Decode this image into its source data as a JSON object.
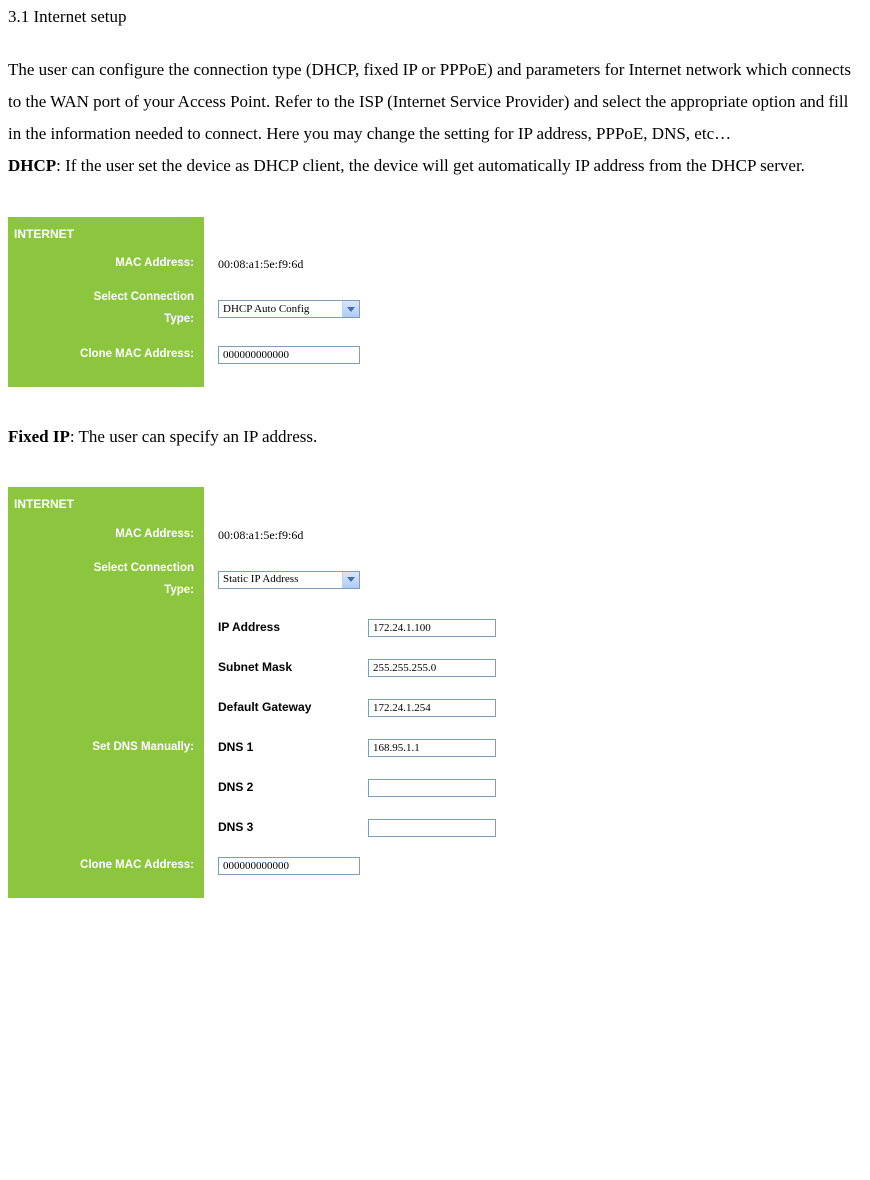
{
  "section": "3.1 Internet setup",
  "intro_paragraph": "The user can configure the connection type (DHCP, fixed IP or PPPoE) and parameters for Internet network which connects to the WAN port of your Access Point. Refer to the ISP (Internet Service Provider) and select the appropriate option and fill in the information needed to connect. Here you may change the setting for IP address, PPPoE, DNS, etc…",
  "dhcp_label": "DHCP",
  "dhcp_text": ": If the user set the device as DHCP client, the device will get automatically IP address from the DHCP server.",
  "fixedip_label": "Fixed IP",
  "fixedip_text": ": The user can specify an IP address.",
  "panel1": {
    "header": "INTERNET",
    "mac_label": "MAC Address:",
    "mac_value": "00:08:a1:5e:f9:6d",
    "conn_label_line1": "Select Connection",
    "conn_label_line2": "Type:",
    "conn_value": "DHCP Auto Config",
    "clone_label": "Clone MAC Address:",
    "clone_value": "000000000000"
  },
  "panel2": {
    "header": "INTERNET",
    "mac_label": "MAC Address:",
    "mac_value": "00:08:a1:5e:f9:6d",
    "conn_label_line1": "Select Connection",
    "conn_label_line2": "Type:",
    "conn_value": "Static IP Address",
    "fields": {
      "ip_address_label": "IP Address",
      "ip_address_value": "172.24.1.100",
      "subnet_label": "Subnet Mask",
      "subnet_value": "255.255.255.0",
      "gateway_label": "Default Gateway",
      "gateway_value": "172.24.1.254",
      "dns1_label": "DNS 1",
      "dns1_value": "168.95.1.1",
      "dns2_label": "DNS 2",
      "dns2_value": "",
      "dns3_label": "DNS 3",
      "dns3_value": ""
    },
    "dns_manual_label": "Set DNS Manually:",
    "clone_label": "Clone MAC Address:",
    "clone_value": "000000000000"
  }
}
